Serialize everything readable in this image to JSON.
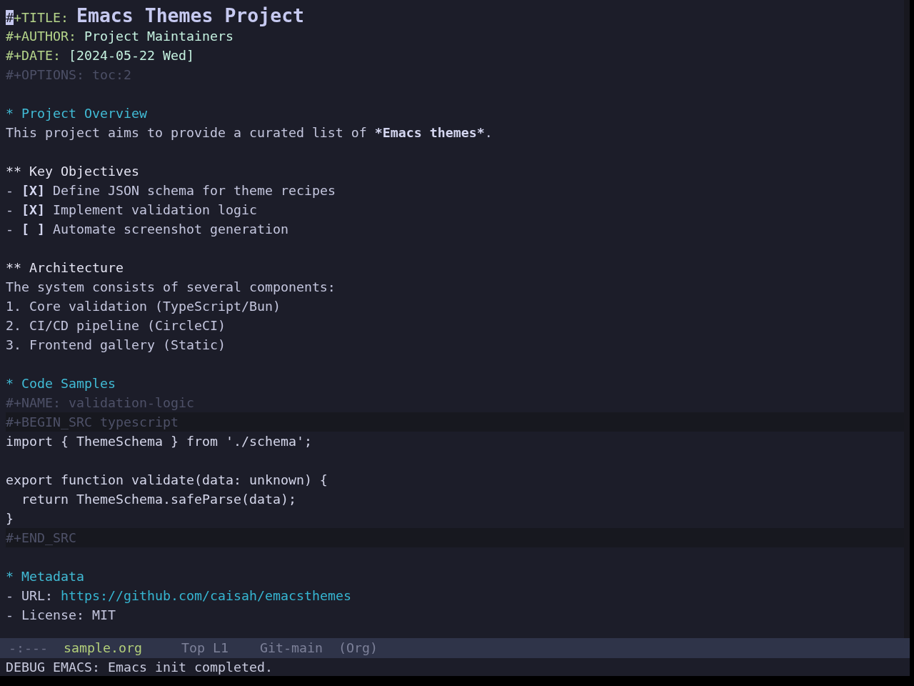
{
  "editor": {
    "header": [
      {
        "kind": "title",
        "key": "#+TITLE:",
        "value": "Emacs Themes Project",
        "cursor": true
      },
      {
        "kind": "info",
        "key": "#+AUTHOR:",
        "value": "Project Maintainers",
        "cursor": false
      },
      {
        "kind": "info",
        "key": "#+DATE:",
        "value": "[2024-05-22 Wed]",
        "cursor": false
      },
      {
        "kind": "setting",
        "key": "#+OPTIONS:",
        "value": "toc:2",
        "cursor": false
      }
    ],
    "sections": [
      {
        "marker": "*",
        "title": "Project Overview",
        "body": [
          {
            "kind": "paragraph",
            "parts": [
              {
                "text": "This project aims to provide a curated list of ",
                "bold": false
              },
              {
                "text": "*Emacs themes*",
                "bold": true
              },
              {
                "text": ".",
                "bold": false
              }
            ]
          }
        ],
        "children": [
          {
            "marker": "**",
            "title": "Key Objectives",
            "body": [
              {
                "kind": "checklist",
                "bullet": "-",
                "box": "[X]",
                "text": "Define JSON schema for theme recipes"
              },
              {
                "kind": "checklist",
                "bullet": "-",
                "box": "[X]",
                "text": "Implement validation logic"
              },
              {
                "kind": "checklist",
                "bullet": "-",
                "box": "[ ]",
                "text": "Automate screenshot generation"
              }
            ]
          },
          {
            "marker": "**",
            "title": "Architecture",
            "body": [
              {
                "kind": "paragraph",
                "parts": [
                  {
                    "text": "The system consists of several components:",
                    "bold": false
                  }
                ]
              },
              {
                "kind": "numbered",
                "number": "1.",
                "text": "Core validation (TypeScript/Bun)"
              },
              {
                "kind": "numbered",
                "number": "2.",
                "text": "CI/CD pipeline (CircleCI)"
              },
              {
                "kind": "numbered",
                "number": "3.",
                "text": "Frontend gallery (Static)"
              }
            ]
          }
        ]
      },
      {
        "marker": "*",
        "title": "Code Samples",
        "body": [
          {
            "kind": "src_block",
            "name_line": "#+NAME: validation-logic",
            "begin_line": "#+BEGIN_SRC typescript",
            "code": "import { ThemeSchema } from './schema';\n\nexport function validate(data: unknown) {\n  return ThemeSchema.safeParse(data);\n}",
            "end_line": "#+END_SRC"
          }
        ]
      },
      {
        "marker": "*",
        "title": "Metadata",
        "body": [
          {
            "kind": "field",
            "bullet": "-",
            "label": "URL:",
            "link": "https://github.com/caisah/emacsthemes"
          },
          {
            "kind": "field",
            "bullet": "-",
            "label": "License:",
            "value": "MIT"
          }
        ]
      }
    ]
  },
  "mode_line": {
    "state": "-:---",
    "buffer_name": "sample.org",
    "position": "Top L1",
    "vc_branch": "Git-main",
    "major_mode": "(Org)"
  },
  "echo_area": "DEBUG EMACS: Emacs init completed."
}
